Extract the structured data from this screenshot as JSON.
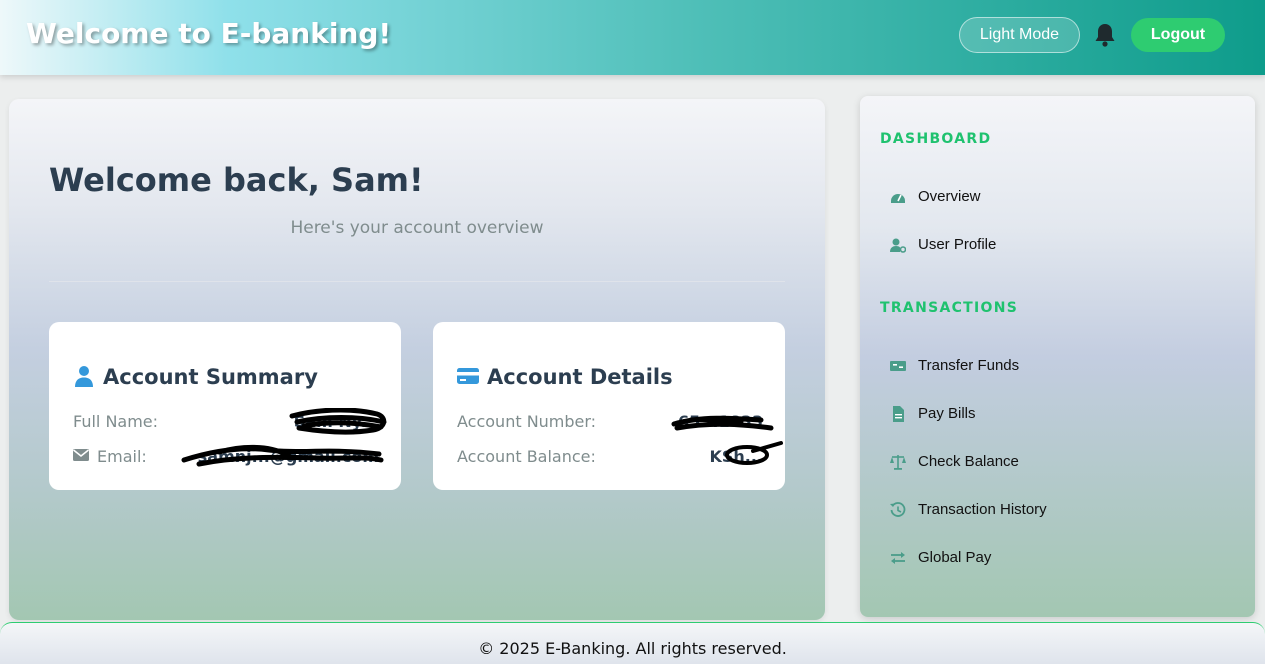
{
  "header": {
    "title": "Welcome to E-banking!",
    "theme_toggle_label": "Light Mode",
    "notification_icon": "bell-icon",
    "logout_label": "Logout"
  },
  "main": {
    "greeting": "Welcome back, Sam!",
    "subtitle": "Here's your account overview",
    "summary_card": {
      "icon": "user-icon",
      "title": "Account Summary",
      "full_name_label": "Full Name:",
      "full_name_value": "Sam Ny...",
      "email_icon": "envelope-icon",
      "email_label": "Email:",
      "email_value": "samnj...@gmail.com"
    },
    "details_card": {
      "icon": "credit-card-icon",
      "title": "Account Details",
      "account_number_label": "Account Number:",
      "account_number_value": "65...1833",
      "balance_label": "Account Balance:",
      "balance_value": "KSh..."
    }
  },
  "sidebar": {
    "dashboard_title": "DASHBOARD",
    "dashboard_items": [
      {
        "label": "Overview",
        "icon": "gauge-icon"
      },
      {
        "label": "User Profile",
        "icon": "user-gear-icon"
      }
    ],
    "transactions_title": "TRANSACTIONS",
    "transactions_items": [
      {
        "label": "Transfer Funds",
        "icon": "money-bill-icon"
      },
      {
        "label": "Pay Bills",
        "icon": "file-invoice-icon"
      },
      {
        "label": "Check Balance",
        "icon": "scale-icon"
      },
      {
        "label": "Transaction History",
        "icon": "history-icon"
      },
      {
        "label": "Global Pay",
        "icon": "exchange-icon"
      }
    ]
  },
  "footer": {
    "text": "© 2025 E-Banking. All rights reserved."
  },
  "colors": {
    "accent_green": "#2ecc71",
    "section_green": "#1fc26f",
    "icon_teal": "#4a9d8a",
    "icon_blue": "#3498db",
    "heading_dark": "#2c3e50"
  }
}
